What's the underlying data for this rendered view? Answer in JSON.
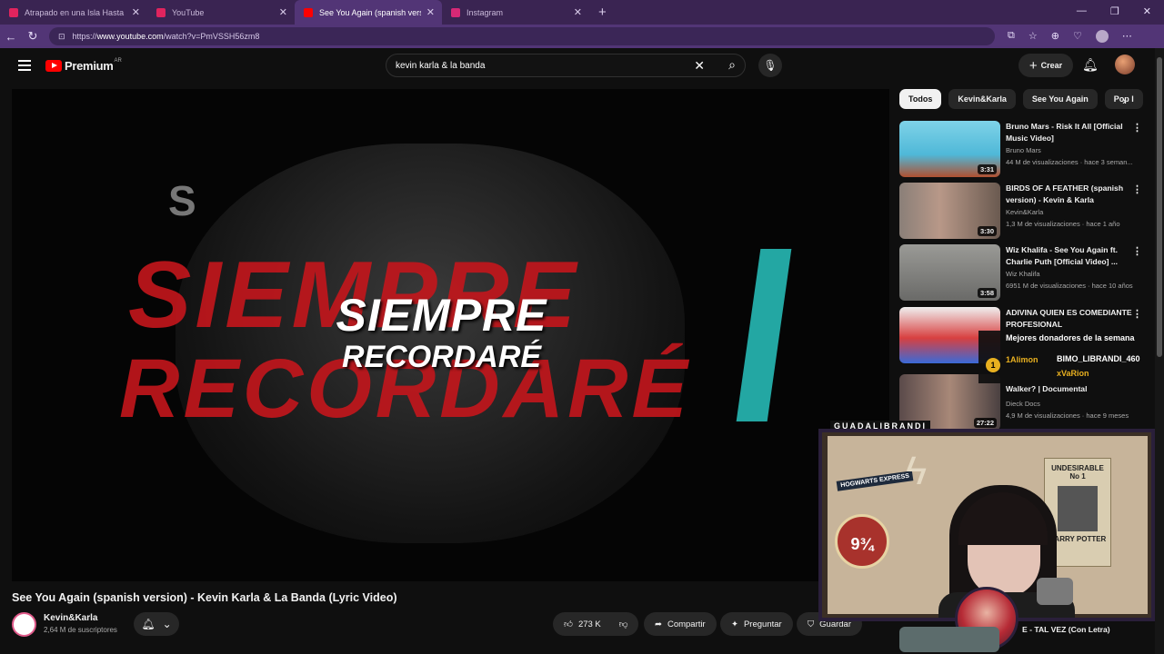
{
  "browser": {
    "tabs": [
      {
        "label": "Atrapado en una Isla Hasta que Co",
        "active": false,
        "fav": "#e0245e"
      },
      {
        "label": "YouTube",
        "active": false,
        "fav": "#e0245e"
      },
      {
        "label": "See You Again (spanish versio",
        "active": true,
        "fav": "#ff0000"
      },
      {
        "label": "Instagram",
        "active": false,
        "fav": "#d62976"
      }
    ],
    "url_prefix": "https://",
    "url_host": "www.youtube.com",
    "url_path": "/watch?v=PmVSSH56zm8"
  },
  "header": {
    "brand": "Premium",
    "country": "AR",
    "search_value": "kevin karla & la banda",
    "create_label": "Crear"
  },
  "video": {
    "overlay_big_1": "SIEMPRE",
    "overlay_big_2": "RECORDARÉ",
    "overlay_mid_1": "SIEMPRE",
    "overlay_mid_2": "RECORDARÉ",
    "title": "See You Again (spanish version) - Kevin Karla & La Banda (Lyric Video)",
    "channel": "Kevin&Karla",
    "subscribers": "2,64 M de suscriptores",
    "likes": "273 K",
    "share": "Compartir",
    "ask": "Preguntar",
    "save": "Guardar"
  },
  "chips": [
    "Todos",
    "Kevin&Karla",
    "See You Again",
    "Pop l"
  ],
  "recommendations": [
    {
      "title": "Bruno Mars - Risk It All [Official Music Video]",
      "channel": "Bruno Mars",
      "meta": "44 M de visualizaciones · hace 3 seman...",
      "duration": "3:31",
      "thumb": "#4fb8d8"
    },
    {
      "title": "BIRDS OF A FEATHER (spanish version) - Kevin & Karla",
      "channel": "Kevin&Karla",
      "meta": "1,3 M de visualizaciones · hace 1 año",
      "duration": "3:30",
      "thumb": "#a08070"
    },
    {
      "title": "Wiz Khalifa - See You Again ft. Charlie Puth [Official Video] ...",
      "channel": "Wiz Khalifa",
      "meta": "6951 M de visualizaciones · hace 10 años",
      "duration": "3:58",
      "thumb": "#7a7a78"
    },
    {
      "title": "ADIVINA QUIEN ES COMEDIANTE PROFESIONAL",
      "channel": "",
      "meta": "",
      "duration": "",
      "thumb": "#c83a3a"
    },
    {
      "title": "Walker? | Documental",
      "channel": "Dieck Docs",
      "meta": "4,9 M de visualizaciones · hace 9 meses",
      "duration": "27:22",
      "thumb": "#8c6a5a"
    }
  ],
  "peek_title": "E - TAL VEZ (Con Letra)",
  "stream": {
    "donors_header": "Mejores donadores de la semana",
    "donor_1": "1Alimon",
    "donor_2": "BIMO_LIBRANDI_460",
    "donor_3": "xVaRion",
    "coin": "1",
    "cam_label": "GUADALIBRANDI",
    "poster_text": "UNDESIRABLE",
    "poster_no": "No 1",
    "poster_name": "HARRY POTTER",
    "platform": "9¾",
    "express": "HOGWARTS EXPRESS"
  }
}
